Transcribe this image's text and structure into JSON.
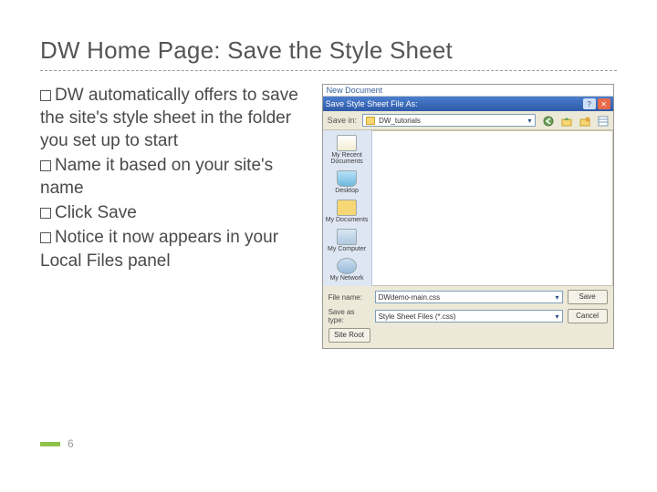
{
  "title": "DW Home Page: Save the Style Sheet",
  "bullets": [
    {
      "lead": "DW",
      "rest": " automatically offers to save the site's style sheet in the folder you set up to start"
    },
    {
      "lead": "Name",
      "rest": " it based on your site's name"
    },
    {
      "lead": "Click",
      "rest": " Save"
    },
    {
      "lead": "Notice",
      "rest": " it now appears in your Local Files panel"
    }
  ],
  "dialog": {
    "outer_title": "New Document",
    "titlebar": "Save Style Sheet File As:",
    "toolbar": {
      "savein_label": "Save in:",
      "savein_value": "DW_tutorials"
    },
    "sidebar": [
      "My Recent Documents",
      "Desktop",
      "My Documents",
      "My Computer",
      "My Network"
    ],
    "fields": {
      "filename_label": "File name:",
      "filename_value": "DWdemo-main.css",
      "saveas_label": "Save as type:",
      "saveas_value": "Style Sheet Files (*.css)"
    },
    "buttons": {
      "save": "Save",
      "cancel": "Cancel",
      "siteroot": "Site Root"
    }
  },
  "page_number": "6"
}
